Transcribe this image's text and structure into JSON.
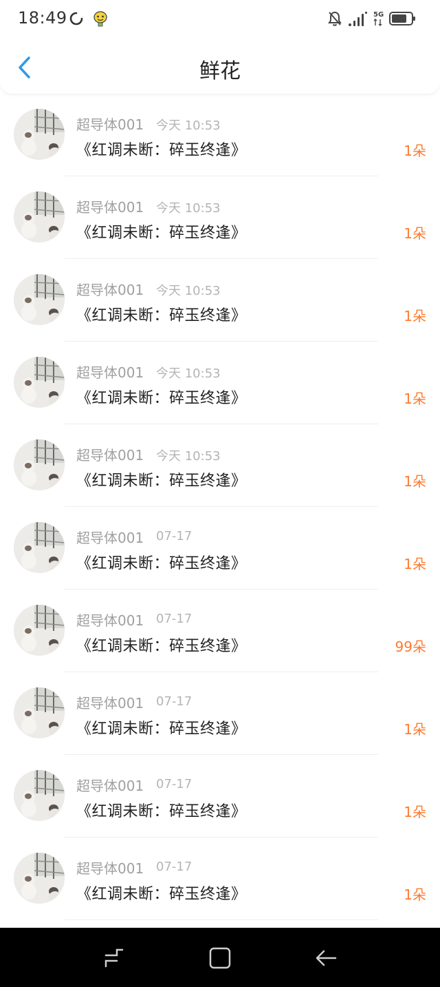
{
  "status_bar": {
    "time": "18:49",
    "network": "5G",
    "icons": [
      "sync-icon",
      "emoji-icon",
      "bell-off-icon",
      "signal-icon",
      "network-5g-icon",
      "battery-icon"
    ]
  },
  "header": {
    "title": "鲜花",
    "back_icon": "chevron-left-icon",
    "accent": "#2b9ce8"
  },
  "colors": {
    "count": "#ff7a2e",
    "sender": "#a0a0a0",
    "time": "#b4b4b4"
  },
  "items": [
    {
      "sender": "超导体001",
      "time": "今天 10:53",
      "message": "《红调未断：碎玉终逢》",
      "count": "1朵"
    },
    {
      "sender": "超导体001",
      "time": "今天 10:53",
      "message": "《红调未断：碎玉终逢》",
      "count": "1朵"
    },
    {
      "sender": "超导体001",
      "time": "今天 10:53",
      "message": "《红调未断：碎玉终逢》",
      "count": "1朵"
    },
    {
      "sender": "超导体001",
      "time": "今天 10:53",
      "message": "《红调未断：碎玉终逢》",
      "count": "1朵"
    },
    {
      "sender": "超导体001",
      "time": "今天 10:53",
      "message": "《红调未断：碎玉终逢》",
      "count": "1朵"
    },
    {
      "sender": "超导体001",
      "time": "07-17",
      "message": "《红调未断：碎玉终逢》",
      "count": "1朵"
    },
    {
      "sender": "超导体001",
      "time": "07-17",
      "message": "《红调未断：碎玉终逢》",
      "count": "99朵"
    },
    {
      "sender": "超导体001",
      "time": "07-17",
      "message": "《红调未断：碎玉终逢》",
      "count": "1朵"
    },
    {
      "sender": "超导体001",
      "time": "07-17",
      "message": "《红调未断：碎玉终逢》",
      "count": "1朵"
    },
    {
      "sender": "超导体001",
      "time": "07-17",
      "message": "《红调未断：碎玉终逢》",
      "count": "1朵"
    }
  ],
  "nav_bar": {
    "icons": [
      "recent-apps-icon",
      "home-icon",
      "back-arrow-icon"
    ]
  }
}
